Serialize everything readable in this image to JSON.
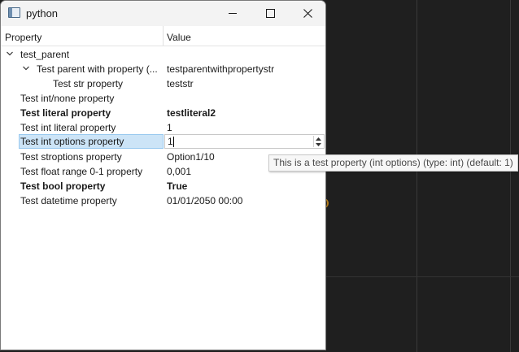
{
  "window": {
    "title": "python",
    "icon": "app-window-icon"
  },
  "header": {
    "property": "Property",
    "value": "Value"
  },
  "rows": [
    {
      "property": "test_parent",
      "value": ""
    },
    {
      "property": "Test parent with property (...",
      "value": "testparentwithpropertystr"
    },
    {
      "property": "Test str property",
      "value": "teststr"
    },
    {
      "property": "Test int/none property",
      "value": ""
    },
    {
      "property": "Test literal property",
      "value": "testliteral2"
    },
    {
      "property": "Test int literal property",
      "value": "1"
    },
    {
      "property": "Test int options property",
      "value": "1"
    },
    {
      "property": "Test stroptions property",
      "value": "Option1/10"
    },
    {
      "property": "Test float range 0-1 property",
      "value": "0,001"
    },
    {
      "property": "Test bool property",
      "value": "True"
    },
    {
      "property": "Test datetime property",
      "value": "01/01/2050 00:00"
    }
  ],
  "tooltip": "This is a test property (int options) (type: int) (default: 1)",
  "colors": {
    "selection": "#cce4f7",
    "selection_border": "#99c9ef",
    "background_dark": "#1f1f1f"
  }
}
